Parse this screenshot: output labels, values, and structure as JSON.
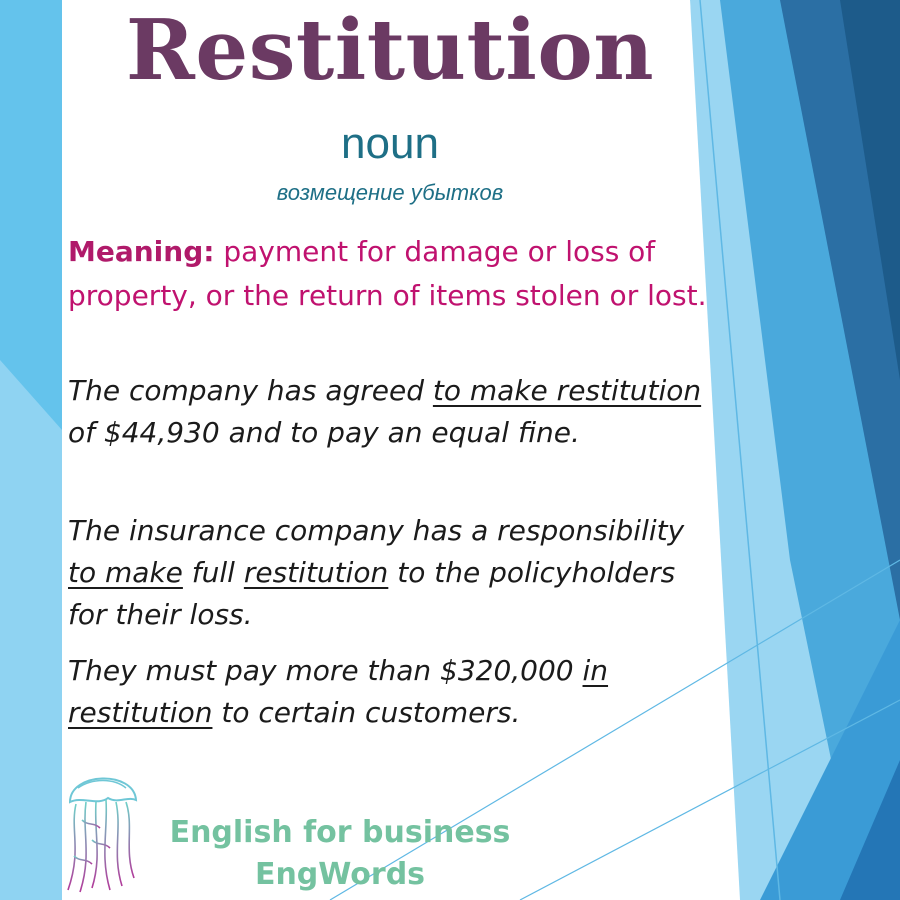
{
  "card": {
    "word": "Restitution",
    "part_of_speech": "noun",
    "translation": "возмещение убытков",
    "meaning_label": "Meaning:",
    "meaning_text": " payment for damage or loss of property, or the return of items stolen or lost."
  },
  "examples": [
    {
      "parts": [
        {
          "text": "The company has agreed ",
          "u": false
        },
        {
          "text": "to make restitution",
          "u": true
        },
        {
          "text": " of $44,930 and to pay an equal fine.",
          "u": false
        }
      ]
    },
    {
      "parts": [
        {
          "text": "The insurance company has a responsibility ",
          "u": false
        },
        {
          "text": "to make",
          "u": true
        },
        {
          "text": " full ",
          "u": false
        },
        {
          "text": "restitution",
          "u": true
        },
        {
          "text": " to the policyholders for their loss.",
          "u": false
        }
      ]
    },
    {
      "parts": [
        {
          "text": "They must pay more than $320,000 ",
          "u": false
        },
        {
          "text": "in restitution",
          "u": true
        },
        {
          "text": " to certain customers.",
          "u": false
        }
      ]
    }
  ],
  "brand": {
    "line1": "English for business",
    "line2": "EngWords"
  },
  "colors": {
    "title": "#6b3a63",
    "pos": "#1e6f86",
    "meaning": "#c0126f",
    "example": "#1b1b1b",
    "brand": "#74c2a0",
    "accent_light_blue": "#6cc4ec",
    "accent_dark_blue": "#1f5f8b"
  },
  "icons": {
    "logo": "jellyfish-logo-icon"
  }
}
